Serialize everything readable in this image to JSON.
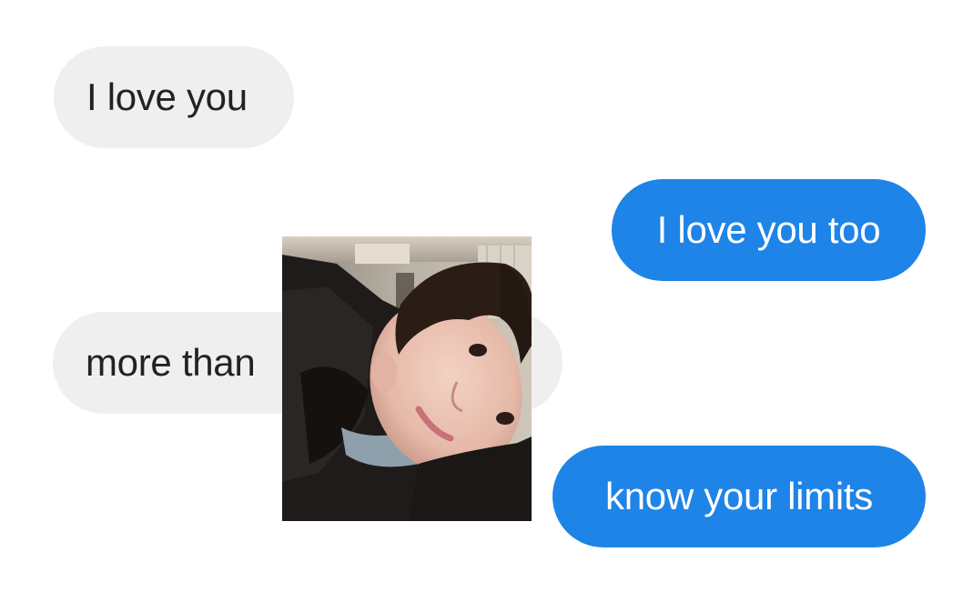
{
  "messages": [
    {
      "direction": "incoming",
      "text": "I love you"
    },
    {
      "direction": "outgoing",
      "text": "I love you too"
    },
    {
      "direction": "incoming",
      "text": "more than"
    },
    {
      "direction": "outgoing",
      "text": "know your limits"
    }
  ],
  "photo": {
    "icon": "person-selfie-photo"
  },
  "colors": {
    "incoming_bubble": "#efefef",
    "incoming_text": "#222222",
    "outgoing_bubble": "#1e84e7",
    "outgoing_text": "#ffffff",
    "background": "#ffffff"
  }
}
